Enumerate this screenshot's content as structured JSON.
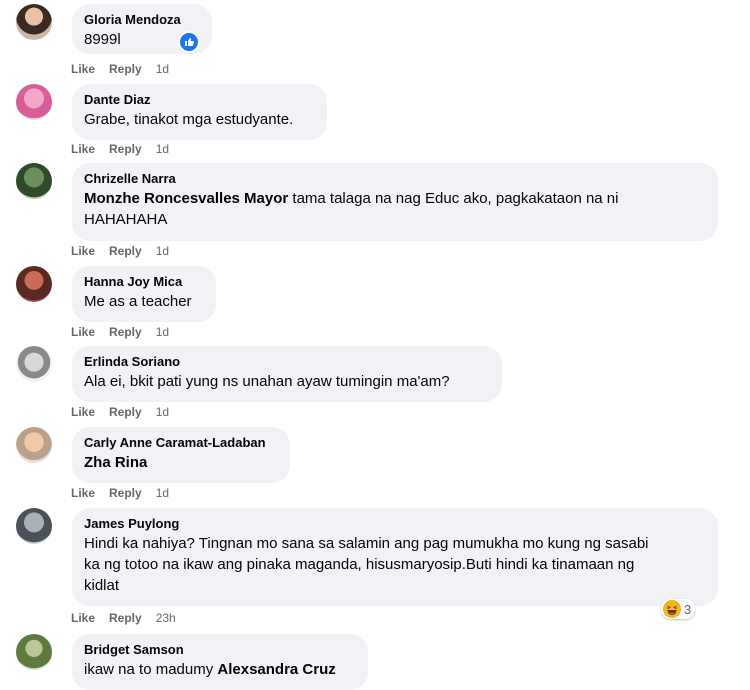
{
  "actions": {
    "like": "Like",
    "reply": "Reply"
  },
  "comments": [
    {
      "author": "Gloria Mendoza",
      "text": "8999l",
      "time": "1d"
    },
    {
      "author": "Dante Diaz",
      "text": "Grabe, tinakot mga estudyante.",
      "time": "1d"
    },
    {
      "author": "Chrizelle Narra",
      "mention": "Monzhe Roncesvalles Mayor",
      "text": " tama talaga na nag Educ ako, pagkakataon na ni",
      "text2": "HAHAHAHA",
      "time": "1d"
    },
    {
      "author": "Hanna Joy Mica",
      "text": "Me as a teacher",
      "time": "1d"
    },
    {
      "author": "Erlinda Soriano",
      "text": "Ala ei, bkit pati yung ns unahan ayaw tumingin ma'am?",
      "time": "1d"
    },
    {
      "author": "Carly Anne Caramat-Ladaban",
      "mention": "Zha Rina",
      "time": "1d"
    },
    {
      "author": "James Puylong",
      "lines": [
        "Hindi ka nahiya? Tingnan mo sana sa salamin ang pag mumukha mo kung ng sasabi",
        "ka ng totoo na ikaw ang pinaka maganda, hisusmaryosip.Buti hindi ka tinamaan ng",
        "kidlat"
      ],
      "time": "23h",
      "reaction_count": "3"
    },
    {
      "author": "Bridget Samson",
      "text": "ikaw na to madumy ",
      "mention": "Alexsandra Cruz"
    }
  ],
  "colors": {
    "bubble": "#f0f2f5",
    "meta": "#65676b",
    "like": "#1877f2",
    "haha": "#f7b125"
  },
  "icons": {
    "like_reaction": "thumbs-up-icon",
    "haha_reaction": "laughing-face-icon"
  }
}
